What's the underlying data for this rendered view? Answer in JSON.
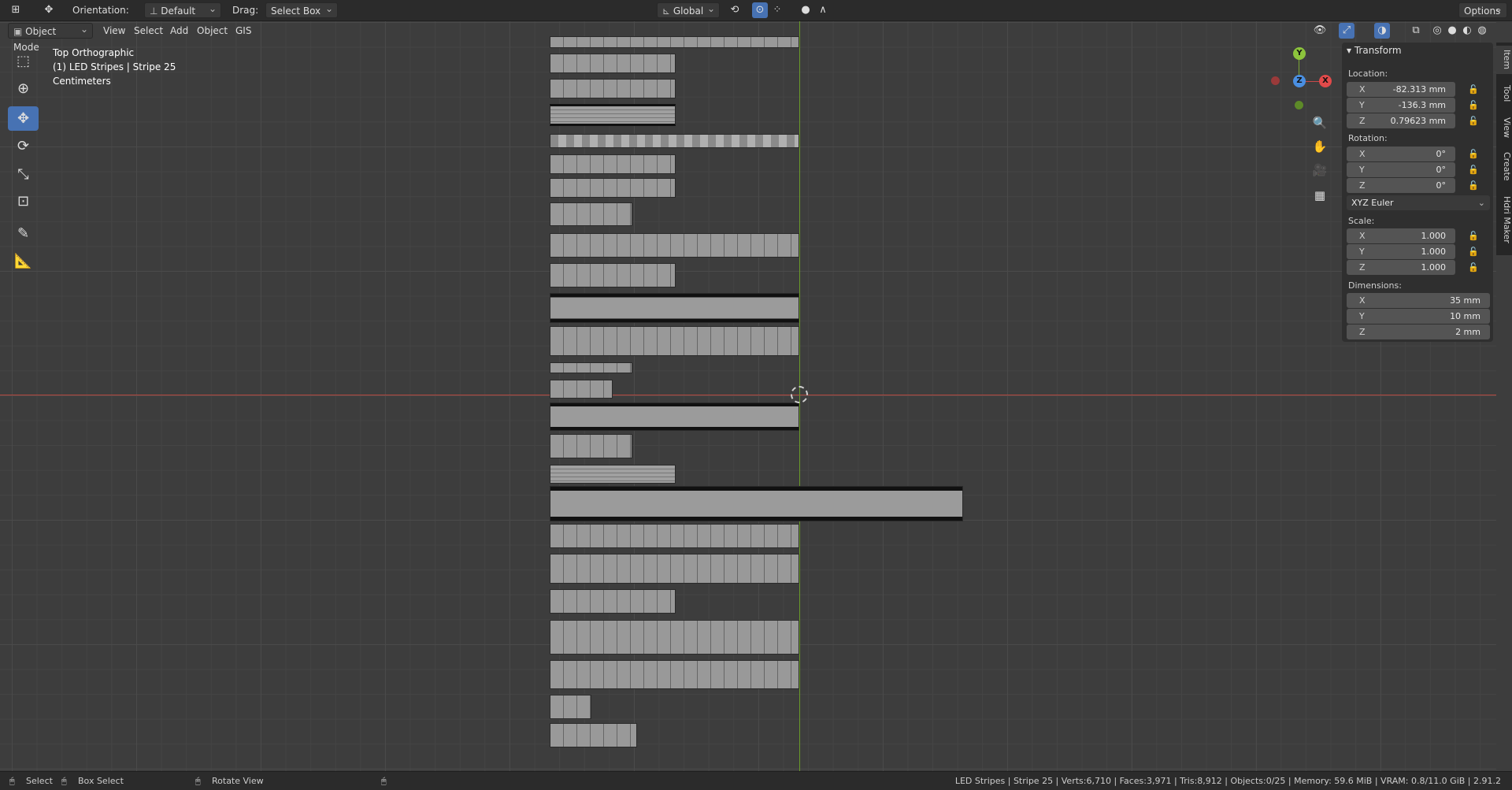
{
  "topbar": {
    "orientation_label": "Orientation:",
    "orientation_value": "Default",
    "drag_label": "Drag:",
    "drag_value": "Select Box",
    "transform_space": "Global",
    "options_label": "Options"
  },
  "viewport_header": {
    "mode": "Object Mode",
    "menus": [
      "View",
      "Select",
      "Add",
      "Object",
      "GIS"
    ]
  },
  "overlay": {
    "view_name": "Top Orthographic",
    "object_info": "(1) LED Stripes | Stripe 25",
    "units": "Centimeters"
  },
  "gizmo": {
    "y": "Y",
    "z": "Z",
    "x": "X"
  },
  "side_tabs": [
    "Item",
    "Tool",
    "View",
    "Create",
    "Hdri Maker"
  ],
  "transform": {
    "title": "Transform",
    "location_label": "Location:",
    "location": [
      {
        "axis": "X",
        "value": "-82.313 mm"
      },
      {
        "axis": "Y",
        "value": "-136.3 mm"
      },
      {
        "axis": "Z",
        "value": "0.79623 mm"
      }
    ],
    "rotation_label": "Rotation:",
    "rotation": [
      {
        "axis": "X",
        "value": "0°"
      },
      {
        "axis": "Y",
        "value": "0°"
      },
      {
        "axis": "Z",
        "value": "0°"
      }
    ],
    "rotation_mode": "XYZ Euler",
    "scale_label": "Scale:",
    "scale": [
      {
        "axis": "X",
        "value": "1.000"
      },
      {
        "axis": "Y",
        "value": "1.000"
      },
      {
        "axis": "Z",
        "value": "1.000"
      }
    ],
    "dimensions_label": "Dimensions:",
    "dimensions": [
      {
        "axis": "X",
        "value": "35 mm"
      },
      {
        "axis": "Y",
        "value": "10 mm"
      },
      {
        "axis": "Z",
        "value": "2 mm"
      }
    ]
  },
  "status": {
    "select": "Select",
    "box_select": "Box Select",
    "rotate_view": "Rotate View",
    "stats": "LED Stripes | Stripe 25 | Verts:6,710 | Faces:3,971 | Tris:8,912 | Objects:0/25 | Memory: 59.6 MiB | VRAM: 0.8/11.0 GiB | 2.91.2"
  }
}
